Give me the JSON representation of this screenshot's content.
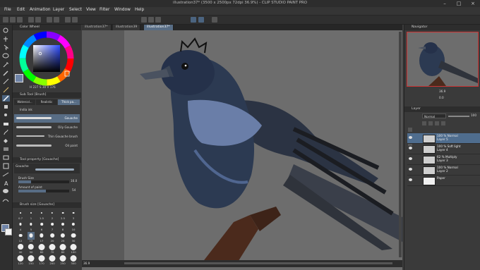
{
  "window": {
    "title": "illustration37* (3500 x 2500px 72dpi 36.9%) - CLIP STUDIO PAINT PRO"
  },
  "menu": [
    "File",
    "Edit",
    "Animation",
    "Layer",
    "Select",
    "View",
    "Filter",
    "Window",
    "Help"
  ],
  "doc_tabs": [
    "illustration37*",
    "illustration39",
    "illustration37*"
  ],
  "color_wheel": {
    "title": "Color Wheel",
    "readout": [
      "H 227",
      "S 30",
      "V 176"
    ]
  },
  "sub_tool": {
    "title": "Sub Tool [Brush]",
    "tabs": [
      "Watercol...",
      "Realistic",
      "Thick pa..."
    ],
    "category": "India ink",
    "brushes": [
      "Gouache",
      "Oily Gouache",
      "Thin Gouache brush",
      "Oil paint"
    ]
  },
  "tool_property": {
    "title": "Tool property [Gouache]",
    "brush_name": "Gouache",
    "brush_size_label": "Brush Size",
    "brush_size_value": "16.0",
    "amount_label": "Amount of paint",
    "amount_value": "54"
  },
  "brush_size": {
    "title": "Brush size [Gouache]",
    "sizes": [
      "0.7",
      "1",
      "1.5",
      "2",
      "2.5",
      "3",
      "4",
      "5",
      "6",
      "7",
      "8",
      "10",
      "12",
      "15",
      "17",
      "20",
      "25",
      "30",
      "40",
      "50",
      "60",
      "70",
      "80",
      "100",
      "120",
      "150",
      "170",
      "200",
      "250",
      "300"
    ],
    "selected_index": 13
  },
  "navigator": {
    "title": "Navigator",
    "zoom": "36.9",
    "angle": "0.0"
  },
  "layer_panel": {
    "tabs": [
      "Layer"
    ],
    "blend_mode": "Normal",
    "opacity": "100",
    "layers": [
      {
        "line1": "100 % Normal",
        "line2": "Layer 5",
        "selected": true
      },
      {
        "line1": "100 % Soft light",
        "line2": "Layer 4",
        "selected": false
      },
      {
        "line1": "62 % Multiply",
        "line2": "Layer 3",
        "selected": false
      },
      {
        "line1": "100 % Normal",
        "line2": "Layer 2",
        "selected": false
      },
      {
        "line1": "",
        "line2": "Paper",
        "selected": false
      }
    ]
  },
  "status": {
    "zoom": "36.9"
  },
  "colors": {
    "accent": "#586d85",
    "canvas_bg": "#6b6b6b",
    "bird_body": "#2c3a52",
    "branch": "#4b2a1c"
  }
}
